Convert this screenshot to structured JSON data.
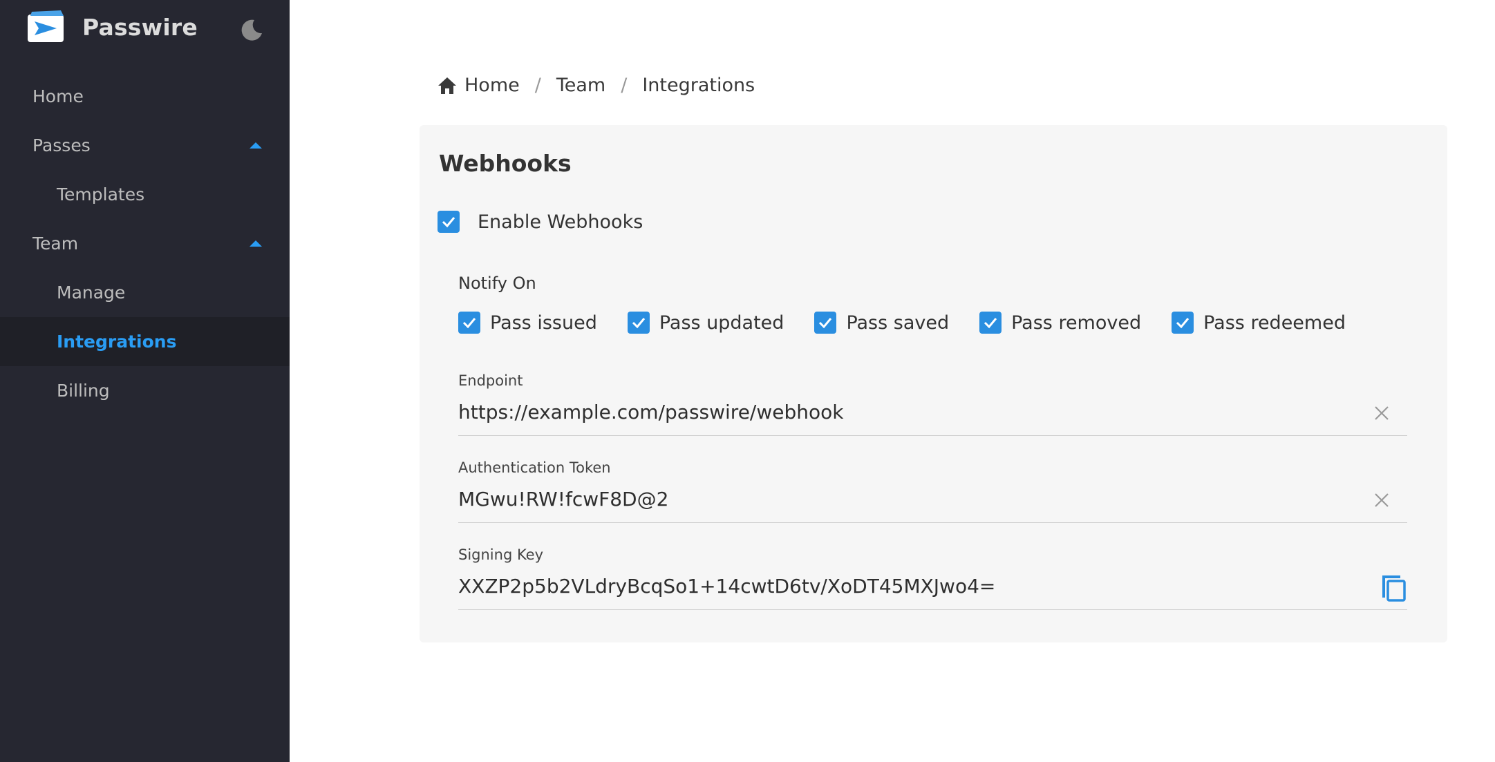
{
  "app": {
    "name": "Passwire",
    "logo_icon": "paper-plane-logo-icon",
    "theme_toggle_icon": "moon-icon"
  },
  "sidebar": {
    "items": [
      {
        "label": "Home",
        "level": 1
      },
      {
        "label": "Passes",
        "level": 1,
        "expanded": true
      },
      {
        "label": "Templates",
        "level": 2
      },
      {
        "label": "Team",
        "level": 1,
        "expanded": true
      },
      {
        "label": "Manage",
        "level": 2
      },
      {
        "label": "Integrations",
        "level": 2,
        "active": true
      },
      {
        "label": "Billing",
        "level": 2
      }
    ]
  },
  "breadcrumb": {
    "items": [
      "Home",
      "Team",
      "Integrations"
    ],
    "separator": "/",
    "home_icon": "home-icon"
  },
  "card": {
    "title": "Webhooks",
    "enable": {
      "label": "Enable Webhooks",
      "checked": true
    },
    "notify": {
      "label": "Notify On",
      "options": [
        {
          "label": "Pass issued",
          "checked": true
        },
        {
          "label": "Pass updated",
          "checked": true
        },
        {
          "label": "Pass saved",
          "checked": true
        },
        {
          "label": "Pass removed",
          "checked": true
        },
        {
          "label": "Pass redeemed",
          "checked": true
        }
      ]
    },
    "endpoint": {
      "label": "Endpoint",
      "value": "https://example.com/passwire/webhook",
      "action_icon": "clear-icon"
    },
    "token": {
      "label": "Authentication Token",
      "value": "MGwu!RW!fcwF8D@2",
      "action_icon": "clear-icon"
    },
    "signing_key": {
      "label": "Signing Key",
      "value": "XXZP2p5b2VLdryBcqSo1+14cwtD6tv/XoDT45MXJwo4=",
      "action_icon": "copy-icon"
    }
  },
  "colors": {
    "sidebar_bg": "#262731",
    "accent": "#2a9df4",
    "checkbox": "#2a8ee0",
    "card_bg": "#f6f6f6"
  }
}
